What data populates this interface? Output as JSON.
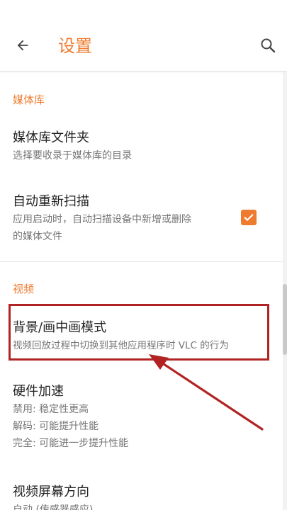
{
  "header": {
    "title": "设置"
  },
  "sections": [
    {
      "category": "媒体库",
      "items": [
        {
          "title": "媒体库文件夹",
          "summary": [
            "选择要收录于媒体库的目录"
          ]
        },
        {
          "title": "自动重新扫描",
          "summary": [
            "应用启动时，自动扫描设备中新增或删除",
            "的媒体文件"
          ],
          "checked": true
        }
      ]
    },
    {
      "category": "视频",
      "items": [
        {
          "title": "背景/画中画模式",
          "summary": [
            "视频回放过程中切换到其他应用程序时 VLC 的行为"
          ]
        },
        {
          "title": "硬件加速",
          "summary": [
            "禁用: 稳定性更高",
            "解码: 可能提升性能",
            "完全: 可能进一步提升性能"
          ]
        },
        {
          "title": "视频屏幕方向",
          "summary": [
            "自动 (传感器感应)"
          ]
        }
      ]
    }
  ],
  "colors": {
    "accent": "#ee7b2f",
    "annotation": "#b22424"
  },
  "icons": {
    "back": "arrow-back-icon",
    "search": "search-icon",
    "check": "checkmark-icon"
  }
}
